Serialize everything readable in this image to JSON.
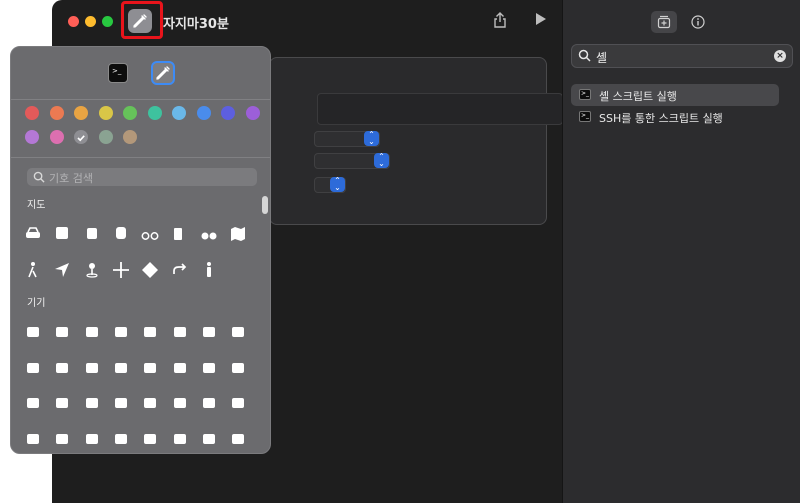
{
  "window": {
    "title": "자지마30분"
  },
  "sidebar": {
    "search": {
      "query": "셸"
    },
    "results": [
      {
        "label": "셸 스크립트 실행",
        "selected": true
      },
      {
        "label": "SSH를 통한 스크립트 실행",
        "selected": false
      }
    ]
  },
  "picker": {
    "search_placeholder": "기호 검색",
    "sections": {
      "map": "지도",
      "devices": "기기"
    },
    "colors": [
      "#e35a5a",
      "#eb7a52",
      "#e9a443",
      "#d9c647",
      "#66c25a",
      "#3ec29e",
      "#6ab8e9",
      "#4a8cec",
      "#5d5fe0",
      "#9c5fd9",
      "#b478d6",
      "#dd6fb0",
      "#8e8e93",
      "#8aa392",
      "#b3987a"
    ],
    "icons": {
      "map": [
        "car-icon",
        "bus-icon",
        "tram-icon",
        "train-icon",
        "bicycle-icon",
        "fuel-pump-icon",
        "binoculars-icon",
        "map-icon",
        "walking-icon",
        "location-arrow-icon",
        "map-pin-icon",
        "move-arrows-icon",
        "turn-sign-icon",
        "redo-arrow-icon",
        "figure-icon"
      ],
      "devices": [
        "car-side-icon",
        "car-pair-icon",
        "car-charge-icon",
        "watch-icon",
        "laptop-icon",
        "keyboard-icon",
        "printer-icon",
        "server-icon",
        "display-icon",
        "gamepad-icon",
        "headphones-icon",
        "ear-icon",
        "speaker-icon",
        "display-phone-icon",
        "airpods-icon",
        "airpods-pro-icon",
        "airpods-case-icon",
        "appletv-icon",
        "homepod-icon",
        "watch-wave-icon",
        "phone-icon",
        "phone-wave-icon",
        "phone-small-icon",
        "tablet-icon",
        "tv-box-icon",
        "ipod-icon",
        "scanner-icon",
        "mac-mini-icon",
        "remote-icon",
        "monitor-icon",
        "vision-pro-icon",
        "hub-icon"
      ]
    }
  }
}
